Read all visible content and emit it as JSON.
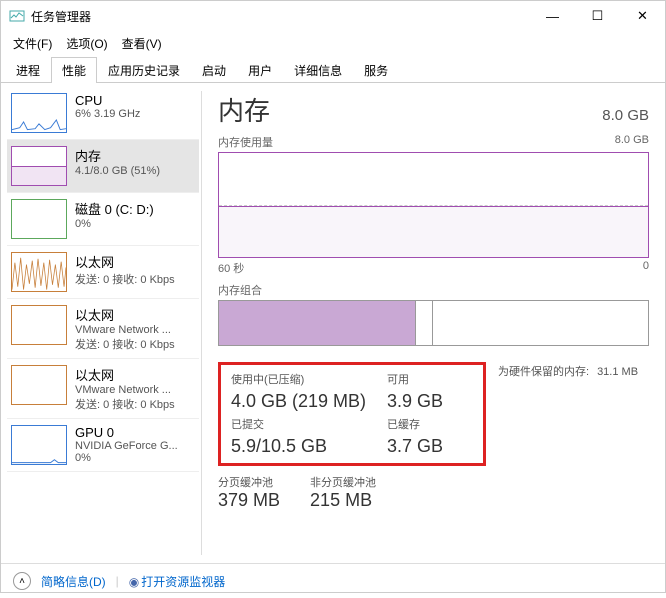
{
  "window": {
    "title": "任务管理器"
  },
  "menu": {
    "file": "文件(F)",
    "options": "选项(O)",
    "view": "查看(V)"
  },
  "tabs": [
    "进程",
    "性能",
    "应用历史记录",
    "启动",
    "用户",
    "详细信息",
    "服务"
  ],
  "active_tab": 1,
  "sidebar": [
    {
      "name": "CPU",
      "sub": "6%  3.19 GHz",
      "kind": "cpu"
    },
    {
      "name": "内存",
      "sub": "4.1/8.0 GB (51%)",
      "kind": "mem",
      "selected": true
    },
    {
      "name": "磁盘 0 (C: D:)",
      "sub": "0%",
      "kind": "disk"
    },
    {
      "name": "以太网",
      "sub": "发送: 0 接收: 0 Kbps",
      "kind": "eth"
    },
    {
      "name": "以太网",
      "sub": "VMware Network ...",
      "sub2": "发送: 0 接收: 0 Kbps",
      "kind": "eth2"
    },
    {
      "name": "以太网",
      "sub": "VMware Network ...",
      "sub2": "发送: 0 接收: 0 Kbps",
      "kind": "eth2"
    },
    {
      "name": "GPU 0",
      "sub": "NVIDIA GeForce G...",
      "sub2": "0%",
      "kind": "gpu"
    }
  ],
  "main": {
    "title": "内存",
    "capacity": "8.0 GB",
    "usage_label": "内存使用量",
    "usage_max": "8.0 GB",
    "axis_left": "60 秒",
    "axis_right": "0",
    "comp_label": "内存组合",
    "stats": {
      "in_use_label": "使用中(已压缩)",
      "in_use_val": "4.0 GB (219 MB)",
      "avail_label": "可用",
      "avail_val": "3.9 GB",
      "commit_label": "已提交",
      "commit_val": "5.9/10.5 GB",
      "cached_label": "已缓存",
      "cached_val": "3.7 GB"
    },
    "reserved_label": "为硬件保留的内存:",
    "reserved_val": "31.1 MB",
    "paged_label": "分页缓冲池",
    "paged_val": "379 MB",
    "nonpaged_label": "非分页缓冲池",
    "nonpaged_val": "215 MB"
  },
  "footer": {
    "brief": "简略信息(D)",
    "resmon": "打开资源监视器"
  },
  "chart_data": {
    "type": "line",
    "title": "内存使用量",
    "xlabel": "60 秒",
    "ylabel": "GB",
    "ylim": [
      0,
      8.0
    ],
    "x": [
      60,
      50,
      40,
      30,
      20,
      10,
      0
    ],
    "values": [
      4.1,
      4.1,
      4.0,
      4.1,
      4.0,
      4.1,
      4.1
    ]
  }
}
